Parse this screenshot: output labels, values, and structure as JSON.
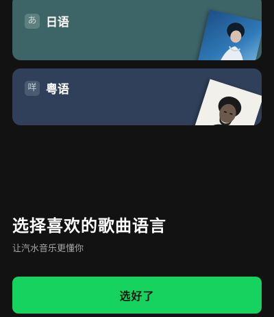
{
  "languages": [
    {
      "badge": "あ",
      "name": "日语",
      "icon": "hiragana-a-icon",
      "color": "#3d6466"
    },
    {
      "badge": "咩",
      "name": "粤语",
      "icon": "cantonese-char-icon",
      "color": "#30405a"
    }
  ],
  "heading": "选择喜欢的歌曲语言",
  "subheading": "让汽水音乐更懂你",
  "confirm_button": {
    "label": "选好了",
    "color": "#16d25f"
  }
}
